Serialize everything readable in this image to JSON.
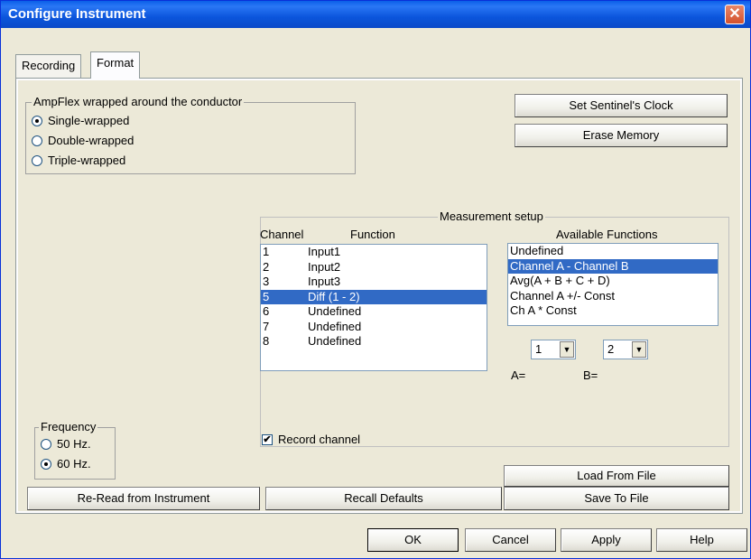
{
  "window": {
    "title": "Configure Instrument",
    "close_glyph": "✕"
  },
  "tabs": [
    {
      "label": "Recording"
    },
    {
      "label": "Format"
    }
  ],
  "ampflex": {
    "legend": "AmpFlex wrapped around the conductor",
    "options": [
      {
        "label": "Single-wrapped",
        "checked": true
      },
      {
        "label": "Double-wrapped",
        "checked": false
      },
      {
        "label": "Triple-wrapped",
        "checked": false
      }
    ]
  },
  "buttons": {
    "sentinel_clock": "Set Sentinel's Clock",
    "erase_memory": "Erase Memory",
    "load_file": "Load From File",
    "reread": "Re-Read from Instrument",
    "recall_defaults": "Recall Defaults",
    "save_file": "Save To File"
  },
  "measurement": {
    "legend": "Measurement setup",
    "channel_header": "Channel",
    "function_header": "Function",
    "channels": [
      {
        "num": "1",
        "fn": "Input1"
      },
      {
        "num": "2",
        "fn": "Input2"
      },
      {
        "num": "3",
        "fn": "Input3"
      },
      {
        "num": "5",
        "fn": "Diff (1 - 2)",
        "selected": true
      },
      {
        "num": "6",
        "fn": "Undefined"
      },
      {
        "num": "7",
        "fn": "Undefined"
      },
      {
        "num": "8",
        "fn": "Undefined"
      }
    ],
    "available_header": "Available Functions",
    "functions": [
      {
        "label": "Undefined"
      },
      {
        "label": "Channel A - Channel B",
        "selected": true
      },
      {
        "label": "Avg(A + B + C + D)"
      },
      {
        "label": "Channel A +/- Const"
      },
      {
        "label": "Ch A * Const"
      }
    ],
    "a_label": "A=",
    "a_value": "1",
    "b_label": "B=",
    "b_value": "2",
    "record_channel": "Record channel",
    "record_checked": true
  },
  "frequency": {
    "legend": "Frequency",
    "options": [
      {
        "label": "50 Hz.",
        "checked": false
      },
      {
        "label": "60 Hz.",
        "checked": true
      }
    ]
  },
  "footer": {
    "ok": "OK",
    "cancel": "Cancel",
    "apply": "Apply",
    "help": "Help"
  },
  "icons": {
    "check": "✔",
    "dropdown": "▼"
  },
  "colors": {
    "titlebar": "#0a5fe8",
    "selection": "#316ac5",
    "face": "#ece9d8"
  }
}
